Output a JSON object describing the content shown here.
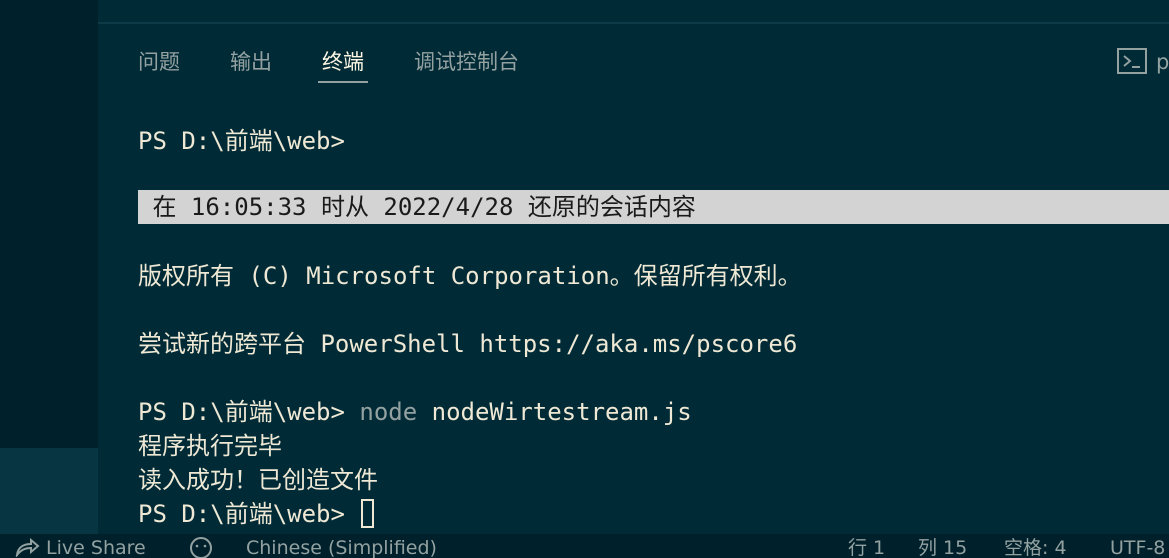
{
  "panel": {
    "tabs": [
      {
        "label": "问题"
      },
      {
        "label": "输出"
      },
      {
        "label": "终端"
      },
      {
        "label": "调试控制台"
      }
    ],
    "terminal_name": "p",
    "terminal_icon": "terminal-icon"
  },
  "terminal": {
    "lines": [
      "PS D:\\前端\\web>",
      " 在 16:05:33 时从 2022/4/28 还原的会话内容",
      "版权所有 (C) Microsoft Corporation。保留所有权利。",
      "尝试新的跨平台 PowerShell https://aka.ms/pscore6",
      "PS D:\\前端\\web> ",
      "node",
      " nodeWirtestream.js",
      "程序执行完毕",
      "读入成功！已创造文件",
      "PS D:\\前端\\web> "
    ]
  },
  "statusbar": {
    "live_share": "Live Share",
    "language": "Chinese (Simplified)",
    "line": "行 1",
    "column": "列 15",
    "spaces": "空格: 4",
    "encoding": "UTF-8"
  },
  "colors": {
    "background": "#002b36",
    "banner": "#d3d3d3",
    "text": "#eee8d5"
  }
}
